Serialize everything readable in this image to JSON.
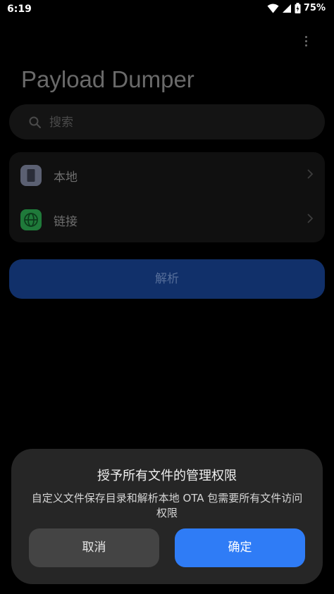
{
  "status_bar": {
    "time": "6:19",
    "battery": "75%"
  },
  "app": {
    "title": "Payload Dumper"
  },
  "search": {
    "placeholder": "搜索",
    "value": ""
  },
  "sources": [
    {
      "label": "本地",
      "icon": "phone-icon",
      "color": "#5b6072"
    },
    {
      "label": "链接",
      "icon": "globe-icon",
      "color": "#1f7a3a"
    }
  ],
  "actions": {
    "parse_label": "解析"
  },
  "dialog": {
    "title": "授予所有文件的管理权限",
    "message": "自定义文件保存目录和解析本地 OTA 包需要所有文件访问权限",
    "cancel_label": "取消",
    "confirm_label": "确定"
  },
  "colors": {
    "accent": "#2f7cf6",
    "parse_button": "#11306a",
    "dialog_bg": "#262626"
  }
}
